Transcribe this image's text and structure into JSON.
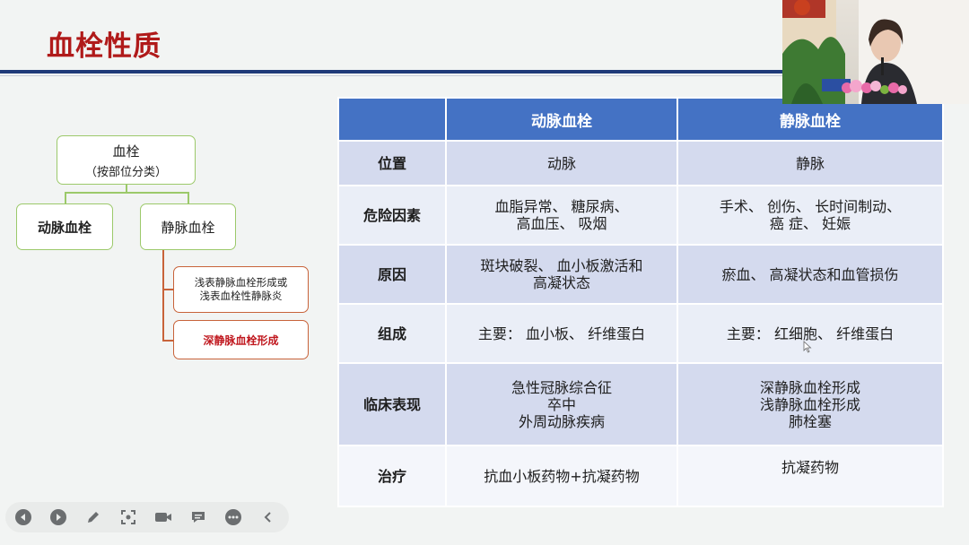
{
  "slide": {
    "title": "血栓性质"
  },
  "tree": {
    "root_line1": "血栓",
    "root_line2": "（按部位分类）",
    "arterial": "动脉血栓",
    "venous": "静脉血栓",
    "superficial_line1": "浅表静脉血栓形成或",
    "superficial_line2": "浅表血栓性静脉炎",
    "deep": "深静脉血栓形成"
  },
  "table": {
    "headers": [
      "",
      "动脉血栓",
      "静脉血栓"
    ],
    "rows": [
      {
        "label": "位置",
        "arterial": [
          "动脉"
        ],
        "venous": [
          "静脉"
        ]
      },
      {
        "label": "危险因素",
        "arterial": [
          "血脂异常、 糖尿病、",
          "高血压、 吸烟"
        ],
        "venous": [
          "手术、 创伤、 长时间制动、",
          "癌 症、 妊娠"
        ]
      },
      {
        "label": "原因",
        "arterial": [
          "斑块破裂、 血小板激活和",
          "高凝状态"
        ],
        "venous": [
          "瘀血、 高凝状态和血管损伤"
        ]
      },
      {
        "label": "组成",
        "arterial": [
          "主要： 血小板、 纤维蛋白"
        ],
        "venous": [
          "主要： 红细胞、 纤维蛋白"
        ]
      },
      {
        "label": "临床表现",
        "arterial": [
          "急性冠脉综合征",
          "卒中",
          "外周动脉疾病"
        ],
        "venous": [
          "深静脉血栓形成",
          "浅静脉血栓形成",
          "肺栓塞"
        ]
      },
      {
        "label": "治疗",
        "arterial": [
          "抗血小板药物+抗凝药物"
        ],
        "venous": [
          "抗凝药物"
        ]
      }
    ]
  },
  "webcam": {
    "icon": "speaker-video"
  },
  "toolbar": {
    "icons": [
      "prev-icon",
      "play-icon",
      "pen-icon",
      "screenshot-icon",
      "camera-icon",
      "comment-icon",
      "more-icon",
      "collapse-icon"
    ]
  },
  "colors": {
    "title_red": "#b01a1a",
    "header_blue": "#4472c4",
    "rule_navy": "#1f3a78",
    "node_green": "#9cc96a",
    "node_orange": "#c8633a",
    "deep_red_text": "#c0181f"
  }
}
